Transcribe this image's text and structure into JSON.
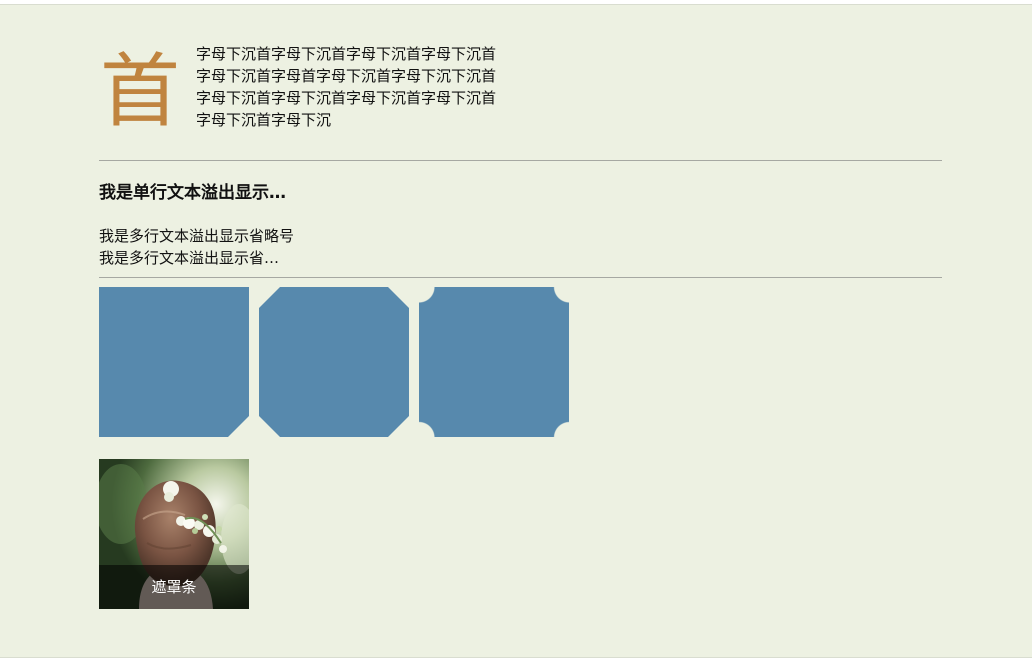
{
  "dropcap": {
    "initial": "首",
    "text": "字母下沉首字母下沉首字母下沉首字母下沉首字母下沉首字母首字母下沉首字母下沉下沉首字母下沉首字母下沉首字母下沉首字母下沉首字母下沉首字母下沉"
  },
  "single_line_text": "我是单行文本溢出显示省略号我是单行文本溢出显示省略号",
  "multi_line_text": "我是多行文本溢出显示省略号我是多行文本溢出显示省略号我是多行文本溢出显示省略号",
  "shapes": {
    "color": "#5789ad",
    "names": [
      "corner-cut-shape",
      "octagon-shape",
      "inverted-round-corner-shape"
    ]
  },
  "photo": {
    "description_icon": "girl-with-flower-crown-photo",
    "mask_label": "遮罩条"
  },
  "colors": {
    "background": "#edf1e2",
    "dropcap": "#c0843f",
    "shape": "#5789ad",
    "divider": "#a6a8a2"
  }
}
